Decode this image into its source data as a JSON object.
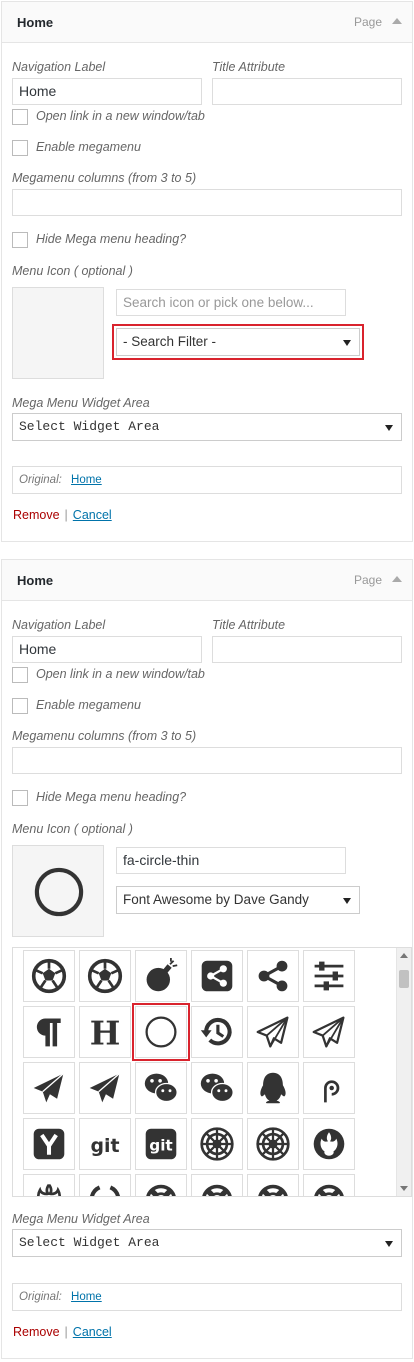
{
  "panels": [
    {
      "title": "Home",
      "type": "Page",
      "nav_label": "Navigation Label",
      "nav_value": "Home",
      "title_attr_label": "Title Attribute",
      "title_attr_value": "",
      "open_new_window": "Open link in a new window/tab",
      "enable_megamenu": "Enable megamenu",
      "columns_label": "Megamenu columns (from 3 to 5)",
      "columns_value": "",
      "hide_heading": "Hide Mega menu heading?",
      "icon_label": "Menu Icon ( optional )",
      "icon_search_placeholder": "Search icon or pick one below...",
      "icon_filter": "- Search Filter -",
      "widget_area_label": "Mega Menu Widget Area",
      "widget_area_value": "Select Widget Area",
      "original_label": "Original:",
      "original_link": "Home",
      "remove": "Remove",
      "separator": "|",
      "cancel": "Cancel"
    },
    {
      "title": "Home",
      "type": "Page",
      "nav_label": "Navigation Label",
      "nav_value": "Home",
      "title_attr_label": "Title Attribute",
      "title_attr_value": "",
      "open_new_window": "Open link in a new window/tab",
      "enable_megamenu": "Enable megamenu",
      "columns_label": "Megamenu columns (from 3 to 5)",
      "columns_value": "",
      "hide_heading": "Hide Mega menu heading?",
      "icon_label": "Menu Icon ( optional )",
      "icon_search_value": "fa-circle-thin",
      "icon_filter": "Font Awesome by Dave Gandy",
      "selected_icon": "circle-thin-icon",
      "widget_area_label": "Mega Menu Widget Area",
      "widget_area_value": "Select Widget Area",
      "original_label": "Original:",
      "original_link": "Home",
      "remove": "Remove",
      "separator": "|",
      "cancel": "Cancel"
    }
  ],
  "icon_grid": [
    [
      "futbol-icon",
      "futbol-icon",
      "bomb-icon",
      "share-alt-square-icon",
      "share-alt-icon",
      "sliders-icon"
    ],
    [
      "paragraph-icon",
      "header-icon",
      "circle-thin-icon",
      "history-icon",
      "paper-plane-o-icon",
      "send-o-icon"
    ],
    [
      "paper-plane-icon",
      "send-icon",
      "wechat-icon",
      "weixin-icon",
      "qq-icon",
      "pied-piper-icon"
    ],
    [
      "y-combinator-icon",
      "git-icon",
      "git-square-icon",
      "galactic-empire-icon",
      "empire-icon",
      "rebel-icon"
    ],
    [
      "ra-icon",
      "circle-o-notch-icon",
      "life-ring-icon",
      "life-buoy-icon",
      "life-saver-icon",
      "support-icon"
    ]
  ],
  "colors": {
    "highlight": "#d9232d",
    "link": "#0073aa",
    "remove": "#aa0000",
    "icon": "#333333"
  }
}
